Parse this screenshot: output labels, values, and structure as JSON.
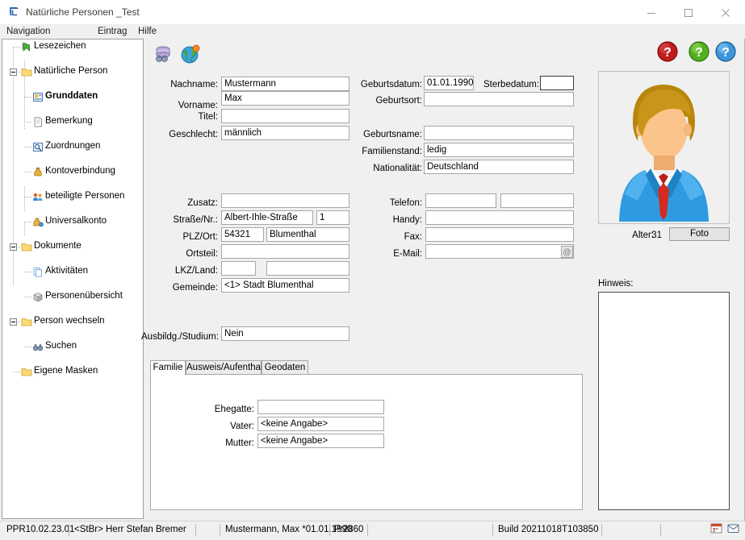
{
  "window": {
    "title": "Natürliche Personen _Test",
    "icon": "app-logo-icon",
    "minimize_label": "Minimieren",
    "maximize_label": "Maximieren",
    "close_label": "Schließen"
  },
  "menubar": {
    "items": [
      {
        "label": "Navigation",
        "name": "menu-navigation"
      },
      {
        "label": "Eintrag",
        "name": "menu-eintrag"
      },
      {
        "label": "Hilfe",
        "name": "menu-hilfe"
      }
    ]
  },
  "sidebar": {
    "items": [
      {
        "label": "Lesezeichen",
        "icon": "bookmark-arrow-icon",
        "level": 1,
        "expander": false,
        "selected": false
      },
      {
        "label": "Natürliche Person",
        "icon": "folder-icon",
        "level": 1,
        "expander": true,
        "selected": false
      },
      {
        "label": "Grunddaten",
        "icon": "form-icon",
        "level": 2,
        "expander": false,
        "selected": true
      },
      {
        "label": "Bemerkung",
        "icon": "note-icon",
        "level": 2,
        "expander": false,
        "selected": false
      },
      {
        "label": "Zuordnungen",
        "icon": "assignment-icon",
        "level": 2,
        "expander": false,
        "selected": false
      },
      {
        "label": "Kontoverbindung",
        "icon": "moneybag-icon",
        "level": 2,
        "expander": false,
        "selected": false
      },
      {
        "label": "beteiligte Personen",
        "icon": "people-icon",
        "level": 2,
        "expander": false,
        "selected": false
      },
      {
        "label": "Universalkonto",
        "icon": "moneybag-plus-icon",
        "level": 2,
        "expander": false,
        "selected": false
      },
      {
        "label": "Dokumente",
        "icon": "folder-icon",
        "level": 1,
        "expander": true,
        "selected": false
      },
      {
        "label": "Aktivitäten",
        "icon": "copy-pages-icon",
        "level": 2,
        "expander": false,
        "selected": false
      },
      {
        "label": "Personenübersicht",
        "icon": "cube-icon",
        "level": 2,
        "expander": false,
        "selected": false
      },
      {
        "label": "Person wechseln",
        "icon": "folder-icon",
        "level": 1,
        "expander": true,
        "selected": false
      },
      {
        "label": "Suchen",
        "icon": "binoculars-icon",
        "level": 2,
        "expander": false,
        "selected": false
      },
      {
        "label": "Eigene Masken",
        "icon": "folder-icon",
        "level": 1,
        "expander": false,
        "selected": false
      }
    ]
  },
  "toolbar": {
    "buttons": [
      {
        "name": "database-search-button",
        "icon": "database-binoculars-icon",
        "label": "Datenbanksuche"
      },
      {
        "name": "globe-button",
        "icon": "globe-pin-icon",
        "label": "Geodaten"
      }
    ],
    "help_buttons": [
      {
        "name": "help-red-button",
        "icon": "question-mark-icon",
        "color": "#b01414",
        "label": "Hilfe rot"
      },
      {
        "name": "help-green-button",
        "icon": "question-mark-icon",
        "color": "#4aa81e",
        "label": "Hilfe grün"
      },
      {
        "name": "help-blue-button",
        "icon": "question-mark-icon",
        "color": "#2f8fd6",
        "label": "Hilfe blau"
      }
    ]
  },
  "form": {
    "personal": {
      "nachname_label": "Nachname:",
      "nachname_value": "Mustermann",
      "vorname_label": "Vorname:",
      "vorname_value": "Max",
      "titel_label": "Titel:",
      "titel_value": "",
      "geschlecht_label": "Geschlecht:",
      "geschlecht_value": "männlich"
    },
    "birth": {
      "geburtsdatum_label": "Geburtsdatum:",
      "geburtsdatum_value": "01.01.1990",
      "sterbedatum_label": "Sterbedatum:",
      "sterbedatum_value": "",
      "geburtsort_label": "Geburtsort:",
      "geburtsort_value": "",
      "geburtsname_label": "Geburtsname:",
      "geburtsname_value": "",
      "familienstand_label": "Familienstand:",
      "familienstand_value": "ledig",
      "nationalitaet_label": "Nationalität:",
      "nationalitaet_value": "Deutschland"
    },
    "address": {
      "zusatz_label": "Zusatz:",
      "zusatz_value": "",
      "strasse_label": "Straße/Nr.:",
      "strasse_value": "Albert-Ihle-Straße",
      "hausnummer_value": "1",
      "plz_label": "PLZ/Ort:",
      "plz_value": "54321",
      "ort_value": "Blumenthal",
      "ortsteil_label": "Ortsteil:",
      "ortsteil_value": "",
      "lkz_label": "LKZ/Land:",
      "lkz_value": "",
      "land_value": "",
      "gemeinde_label": "Gemeinde:",
      "gemeinde_value": "<1> Stadt Blumenthal"
    },
    "contact": {
      "telefon_label": "Telefon:",
      "telefon_value": "",
      "telefon2_value": "",
      "handy_label": "Handy:",
      "handy_value": "",
      "fax_label": "Fax:",
      "fax_value": "",
      "email_label": "E-Mail:",
      "email_value": "",
      "email_button_icon": "at-sign-icon"
    },
    "education": {
      "ausbildung_label": "Ausbildg./Studium:",
      "ausbildung_value": "Nein"
    }
  },
  "tabs": {
    "items": [
      {
        "label": "Familie",
        "name": "tab-familie",
        "active": true
      },
      {
        "label": "Ausweis/Aufenthalt",
        "name": "tab-ausweis-aufenthalt",
        "active": false
      },
      {
        "label": "Geodaten",
        "name": "tab-geodaten",
        "active": false
      }
    ],
    "familie": {
      "ehegatte_label": "Ehegatte:",
      "ehegatte_value": "",
      "vater_label": "Vater:",
      "vater_value": "<keine Angabe>",
      "mutter_label": "Mutter:",
      "mutter_value": "<keine Angabe>"
    }
  },
  "right_panel": {
    "photo_icon": "person-avatar-icon",
    "alter_label": "Alter:",
    "alter_value": "31",
    "foto_button_label": "Foto",
    "hinweis_label": "Hinweis:",
    "hinweis_value": ""
  },
  "statusbar": {
    "version": "PPR10.02.23.01",
    "user": "<StBr> Herr Stefan Bremer",
    "person": "Mustermann, Max *01.01.1990",
    "person_id": "P:2860",
    "build": "Build 20211018T103850",
    "icons": [
      {
        "name": "calendar-icon",
        "label": "Kalender"
      },
      {
        "name": "mail-icon",
        "label": "Nachrichten"
      }
    ]
  }
}
